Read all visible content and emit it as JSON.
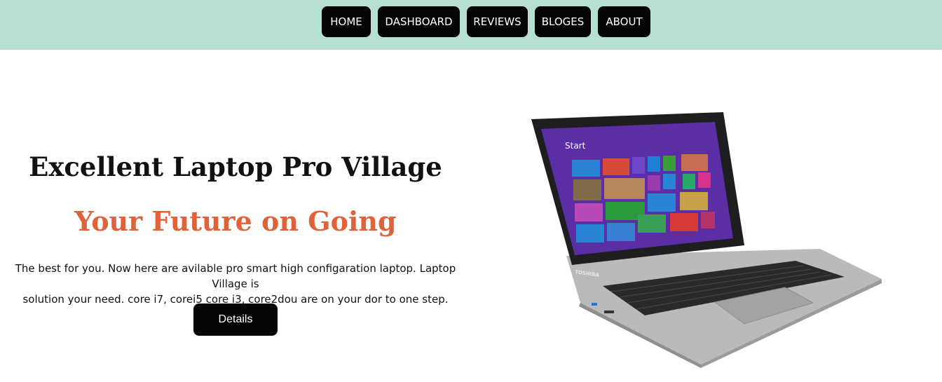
{
  "nav": {
    "items": [
      {
        "label": "HOME"
      },
      {
        "label": "DASHBOARD"
      },
      {
        "label": "REVIEWS"
      },
      {
        "label": "BLOGES"
      },
      {
        "label": "ABOUT"
      }
    ]
  },
  "hero": {
    "title": "Excellent Laptop Pro Village",
    "subtitle": "Your Future on Going",
    "description_line1": "The best for you. Now here are avilable pro smart high configaration laptop. Laptop Village is",
    "description_line2": "solution your need. core i7, corei5 core i3, core2dou are on your dor to one step.",
    "details_button": "Details"
  },
  "laptop_image": {
    "brand": "TOSHIBA",
    "screen_label": "Start",
    "colors": {
      "nav_bg": "#b7e0d4",
      "accent": "#e06238",
      "screen": "#5b2ea6"
    }
  }
}
